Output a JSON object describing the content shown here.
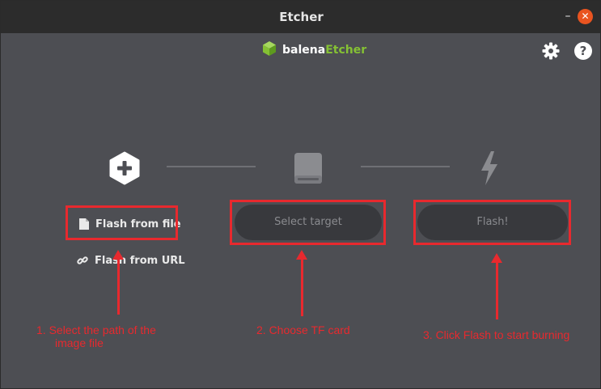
{
  "window": {
    "title": "Etcher",
    "minimize_label": "–",
    "close_label": "✕"
  },
  "brand": {
    "name_part1": "balena",
    "name_part2": "Etcher",
    "accent": "#85c134"
  },
  "header": {
    "settings_icon": "gear-icon",
    "help_icon": "help-icon"
  },
  "steps": {
    "source": {
      "icon": "plus-hex-icon",
      "flash_from_file_label": "Flash from file",
      "flash_from_url_label": "Flash from URL"
    },
    "target": {
      "icon": "drive-icon",
      "select_target_label": "Select target"
    },
    "flash": {
      "icon": "lightning-icon",
      "flash_label": "Flash!"
    }
  },
  "annotations": {
    "note1_line1": "1. Select the path of the",
    "note1_line2": "image file",
    "note2": "2. Choose TF card",
    "note3": "3. Click Flash to start burning",
    "color": "#e8292e"
  }
}
